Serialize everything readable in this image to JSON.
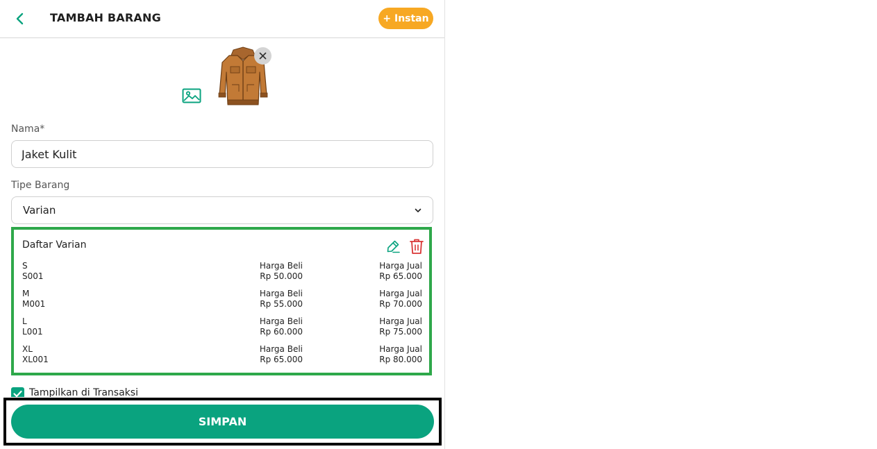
{
  "header": {
    "title": "TAMBAH BARANG",
    "instan_label": "+ Instan"
  },
  "form": {
    "name_label": "Nama*",
    "name_value": "Jaket Kulit",
    "type_label": "Tipe Barang",
    "type_value": "Varian"
  },
  "variants": {
    "title": "Daftar Varian",
    "buy_label": "Harga Beli",
    "sell_label": "Harga Jual",
    "items": [
      {
        "name": "S",
        "sku": "S001",
        "buy": "Rp 50.000",
        "sell": "Rp 65.000"
      },
      {
        "name": "M",
        "sku": "M001",
        "buy": "Rp 55.000",
        "sell": "Rp 70.000"
      },
      {
        "name": "L",
        "sku": "L001",
        "buy": "Rp 60.000",
        "sell": "Rp 75.000"
      },
      {
        "name": "XL",
        "sku": "XL001",
        "buy": "Rp 65.000",
        "sell": "Rp 80.000"
      }
    ]
  },
  "show_in_transaction": {
    "label": "Tampilkan di Transaksi",
    "checked": true
  },
  "footer": {
    "save_label": "SIMPAN"
  },
  "colors": {
    "primary": "#0aa37f",
    "accent": "#f7a823",
    "highlight": "#2ea84a",
    "danger": "#d93636"
  }
}
